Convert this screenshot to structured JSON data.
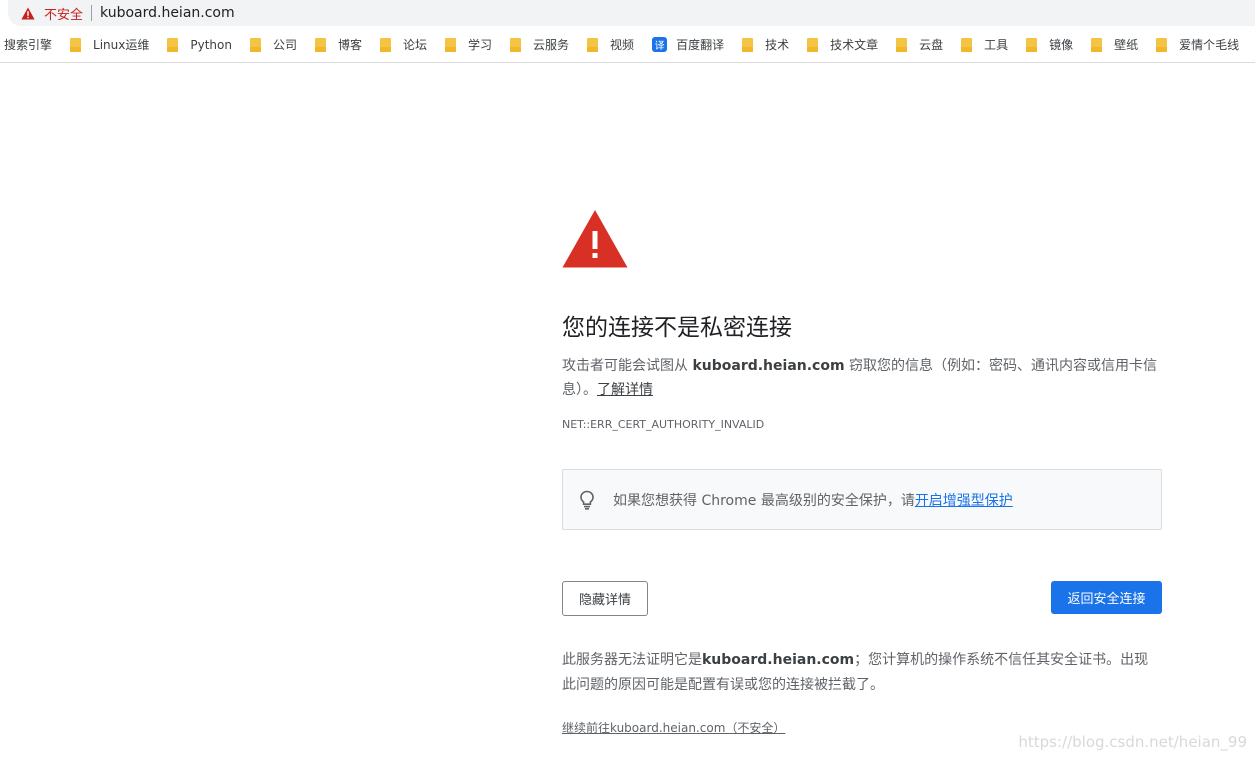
{
  "browser": {
    "security_label": "不安全",
    "url": "kuboard.heian.com"
  },
  "bookmarks": [
    {
      "label": "搜索引擎",
      "icon": "none"
    },
    {
      "label": "Linux运维",
      "icon": "folder-icon"
    },
    {
      "label": "Python",
      "icon": "folder-icon"
    },
    {
      "label": "公司",
      "icon": "folder-icon"
    },
    {
      "label": "博客",
      "icon": "folder-icon"
    },
    {
      "label": "论坛",
      "icon": "folder-icon"
    },
    {
      "label": "学习",
      "icon": "folder-icon"
    },
    {
      "label": "云服务",
      "icon": "folder-icon"
    },
    {
      "label": "视频",
      "icon": "folder-icon"
    },
    {
      "label": "百度翻译",
      "icon": "translate-icon",
      "icon_glyph": "译"
    },
    {
      "label": "技术",
      "icon": "folder-icon"
    },
    {
      "label": "技术文章",
      "icon": "folder-icon"
    },
    {
      "label": "云盘",
      "icon": "folder-icon"
    },
    {
      "label": "工具",
      "icon": "folder-icon"
    },
    {
      "label": "镜像",
      "icon": "folder-icon"
    },
    {
      "label": "壁纸",
      "icon": "folder-icon"
    },
    {
      "label": "爱情个毛线",
      "icon": "folder-icon"
    }
  ],
  "interstitial": {
    "heading": "您的连接不是私密连接",
    "desc_prefix": "攻击者可能会试图从 ",
    "desc_host": "kuboard.heian.com",
    "desc_suffix": " 窃取您的信息（例如：密码、通讯内容或信用卡信息）。",
    "learn_more": "了解详情",
    "error_code": "NET::ERR_CERT_AUTHORITY_INVALID",
    "tip_text": "如果您想获得 Chrome 最高级别的安全保护，请",
    "tip_link": "开启增强型保护",
    "hide_details_label": "隐藏详情",
    "back_label": "返回安全连接",
    "details_prefix": "此服务器无法证明它是",
    "details_host": "kuboard.heian.com",
    "details_suffix": "；您计算机的操作系统不信任其安全证书。出现此问题的原因可能是配置有误或您的连接被拦截了。",
    "proceed_link": "继续前往kuboard.heian.com（不安全）"
  },
  "watermark": "https://blog.csdn.net/heian_99",
  "colors": {
    "warning_red": "#d93025",
    "primary_blue": "#1a73e8",
    "not_secure_red": "#c5221f"
  }
}
